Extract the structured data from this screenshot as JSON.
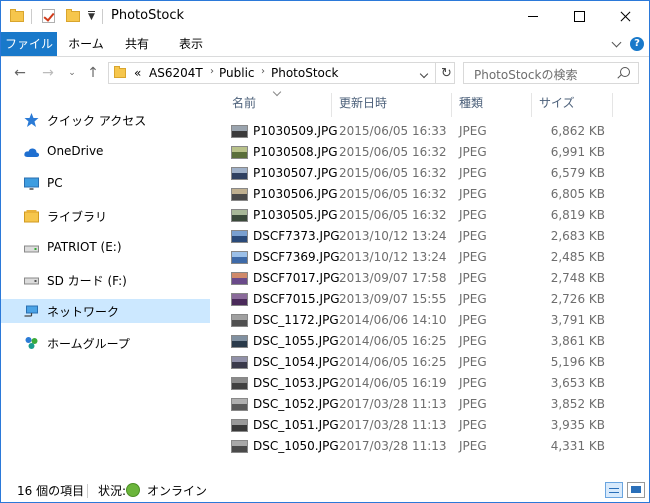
{
  "window": {
    "title": "PhotoStock"
  },
  "ribbon": {
    "tabs": [
      {
        "label": "ファイル"
      },
      {
        "label": "ホーム"
      },
      {
        "label": "共有"
      },
      {
        "label": "表示"
      }
    ]
  },
  "address": {
    "overflow": "«",
    "crumbs": [
      "AS6204T",
      "Public",
      "PhotoStock"
    ]
  },
  "search": {
    "placeholder": "PhotoStockの検索"
  },
  "sidebar": {
    "items": [
      {
        "label": "クイック アクセス",
        "icon": "star-icon"
      },
      {
        "label": "OneDrive",
        "icon": "cloud-icon"
      },
      {
        "label": "PC",
        "icon": "monitor-icon"
      },
      {
        "label": "ライブラリ",
        "icon": "library-icon"
      },
      {
        "label": "PATRIOT (E:)",
        "icon": "drive-icon"
      },
      {
        "label": "SD カード (F:)",
        "icon": "drive-icon"
      },
      {
        "label": "ネットワーク",
        "icon": "network-icon",
        "selected": true
      },
      {
        "label": "ホームグループ",
        "icon": "homegroup-icon"
      }
    ]
  },
  "columns": {
    "name": "名前",
    "date": "更新日時",
    "type": "種類",
    "size": "サイズ"
  },
  "files": [
    {
      "name": "P1030509.JPG",
      "date": "2015/06/05 16:33",
      "type": "JPEG",
      "size": "6,862 KB"
    },
    {
      "name": "P1030508.JPG",
      "date": "2015/06/05 16:32",
      "type": "JPEG",
      "size": "6,991 KB"
    },
    {
      "name": "P1030507.JPG",
      "date": "2015/06/05 16:32",
      "type": "JPEG",
      "size": "6,579 KB"
    },
    {
      "name": "P1030506.JPG",
      "date": "2015/06/05 16:32",
      "type": "JPEG",
      "size": "6,805 KB"
    },
    {
      "name": "P1030505.JPG",
      "date": "2015/06/05 16:32",
      "type": "JPEG",
      "size": "6,819 KB"
    },
    {
      "name": "DSCF7373.JPG",
      "date": "2013/10/12 13:24",
      "type": "JPEG",
      "size": "2,683 KB"
    },
    {
      "name": "DSCF7369.JPG",
      "date": "2013/10/12 13:24",
      "type": "JPEG",
      "size": "2,485 KB"
    },
    {
      "name": "DSCF7017.JPG",
      "date": "2013/09/07 17:58",
      "type": "JPEG",
      "size": "2,748 KB"
    },
    {
      "name": "DSCF7015.JPG",
      "date": "2013/09/07 15:55",
      "type": "JPEG",
      "size": "2,726 KB"
    },
    {
      "name": "DSC_1172.JPG",
      "date": "2014/06/06 14:10",
      "type": "JPEG",
      "size": "3,791 KB"
    },
    {
      "name": "DSC_1055.JPG",
      "date": "2014/06/05 16:25",
      "type": "JPEG",
      "size": "3,861 KB"
    },
    {
      "name": "DSC_1054.JPG",
      "date": "2014/06/05 16:25",
      "type": "JPEG",
      "size": "5,196 KB"
    },
    {
      "name": "DSC_1053.JPG",
      "date": "2014/06/05 16:19",
      "type": "JPEG",
      "size": "3,653 KB"
    },
    {
      "name": "DSC_1052.JPG",
      "date": "2017/03/28 11:13",
      "type": "JPEG",
      "size": "3,852 KB"
    },
    {
      "name": "DSC_1051.JPG",
      "date": "2017/03/28 11:13",
      "type": "JPEG",
      "size": "3,935 KB"
    },
    {
      "name": "DSC_1050.JPG",
      "date": "2017/03/28 11:13",
      "type": "JPEG",
      "size": "4,331 KB"
    }
  ],
  "status": {
    "count": "16 個の項目",
    "state_label": "状況:",
    "state_value": "オンライン"
  },
  "colors": {
    "accent": "#1979ca",
    "selected_nav": "#cce8ff"
  }
}
